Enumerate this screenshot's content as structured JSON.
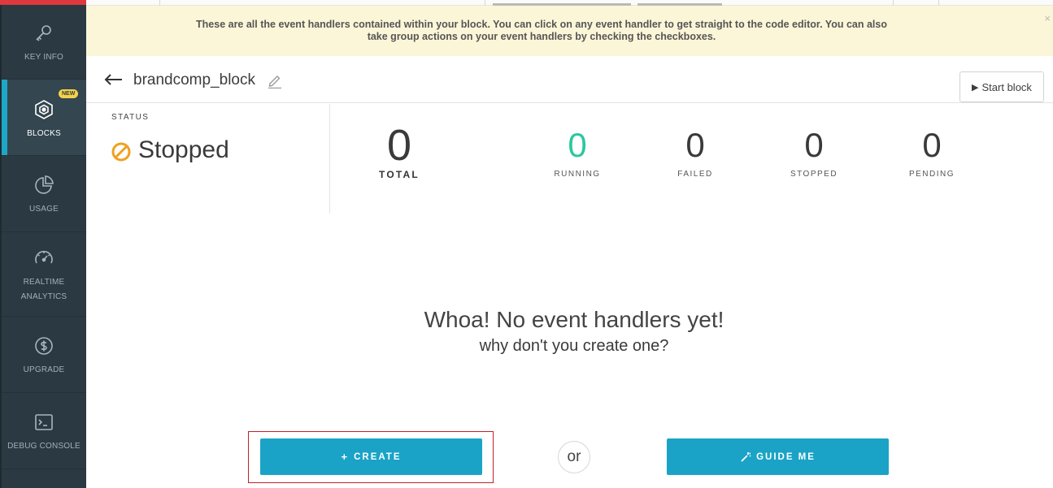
{
  "sidebar": {
    "items": [
      {
        "label": "KEY INFO",
        "icon": "key-icon"
      },
      {
        "label": "BLOCKS",
        "icon": "blocks-icon",
        "badge": "NEW",
        "active": true
      },
      {
        "label": "USAGE",
        "icon": "pie-chart-icon"
      },
      {
        "label": "REALTIME ANALYTICS",
        "icon": "gauge-icon"
      },
      {
        "label": "UPGRADE",
        "icon": "dollar-icon"
      },
      {
        "label": "DEBUG CONSOLE",
        "icon": "terminal-icon"
      }
    ]
  },
  "notice": {
    "text": "These are all the event handlers contained within your block. You can click on any event handler to get straight to the code editor. You can also take group actions on your event handlers by checking the checkboxes.",
    "close": "×"
  },
  "header": {
    "block_name": "brandcomp_block",
    "start_label": "Start block"
  },
  "status": {
    "label": "STATUS",
    "value": "Stopped"
  },
  "stats": {
    "total": {
      "value": "0",
      "label": "TOTAL"
    },
    "running": {
      "value": "0",
      "label": "RUNNING"
    },
    "failed": {
      "value": "0",
      "label": "FAILED"
    },
    "stopped": {
      "value": "0",
      "label": "STOPPED"
    },
    "pending": {
      "value": "0",
      "label": "PENDING"
    }
  },
  "empty": {
    "title": "Whoa! No event handlers yet!",
    "subtitle": "why don't you create one?"
  },
  "actions": {
    "create_label": "CREATE",
    "create_prefix": "+",
    "or_label": "or",
    "guide_label": "GUIDE ME"
  },
  "colors": {
    "sidebar_bg": "#2b3a42",
    "accent": "#1aa3c6",
    "running": "#2cc8a0",
    "stopped_icon": "#f0a020",
    "notice_bg": "#fcf6d8"
  }
}
